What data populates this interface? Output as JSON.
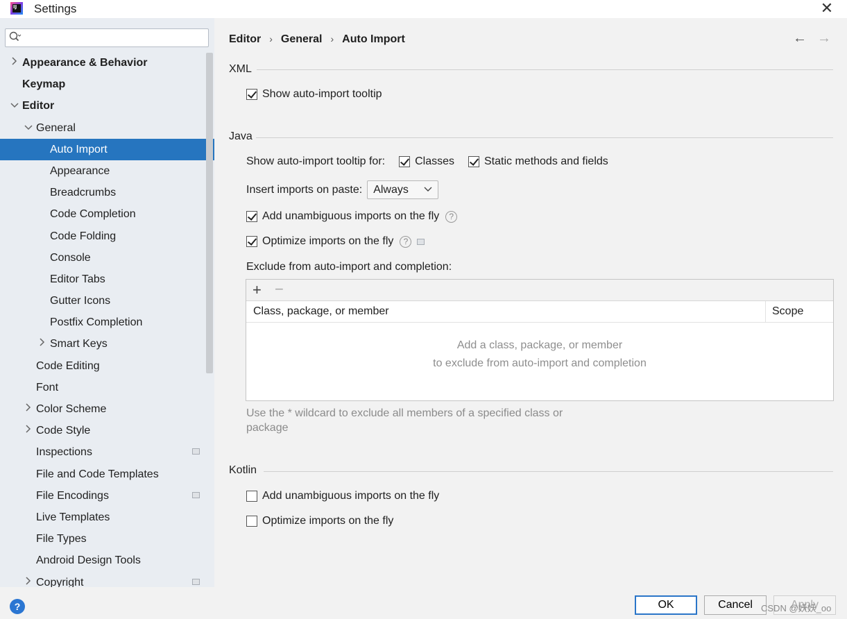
{
  "window": {
    "title": "Settings",
    "app_icon_text": "IJ"
  },
  "search": {
    "placeholder": ""
  },
  "sidebar": {
    "items": [
      {
        "label": "Appearance & Behavior",
        "indent": 0,
        "arrow": "›",
        "bold": true
      },
      {
        "label": "Keymap",
        "indent": 0,
        "arrow": "",
        "bold": true
      },
      {
        "label": "Editor",
        "indent": 0,
        "arrow": "⌄",
        "bold": true
      },
      {
        "label": "General",
        "indent": 1,
        "arrow": "⌄"
      },
      {
        "label": "Auto Import",
        "indent": 2,
        "arrow": "",
        "selected": true
      },
      {
        "label": "Appearance",
        "indent": 2,
        "arrow": ""
      },
      {
        "label": "Breadcrumbs",
        "indent": 2,
        "arrow": ""
      },
      {
        "label": "Code Completion",
        "indent": 2,
        "arrow": ""
      },
      {
        "label": "Code Folding",
        "indent": 2,
        "arrow": ""
      },
      {
        "label": "Console",
        "indent": 2,
        "arrow": ""
      },
      {
        "label": "Editor Tabs",
        "indent": 2,
        "arrow": ""
      },
      {
        "label": "Gutter Icons",
        "indent": 2,
        "arrow": ""
      },
      {
        "label": "Postfix Completion",
        "indent": 2,
        "arrow": ""
      },
      {
        "label": "Smart Keys",
        "indent": 2,
        "arrow": "›"
      },
      {
        "label": "Code Editing",
        "indent": 1,
        "arrow": ""
      },
      {
        "label": "Font",
        "indent": 1,
        "arrow": ""
      },
      {
        "label": "Color Scheme",
        "indent": 1,
        "arrow": "›"
      },
      {
        "label": "Code Style",
        "indent": 1,
        "arrow": "›"
      },
      {
        "label": "Inspections",
        "indent": 1,
        "arrow": "",
        "mini": true
      },
      {
        "label": "File and Code Templates",
        "indent": 1,
        "arrow": ""
      },
      {
        "label": "File Encodings",
        "indent": 1,
        "arrow": "",
        "mini": true
      },
      {
        "label": "Live Templates",
        "indent": 1,
        "arrow": ""
      },
      {
        "label": "File Types",
        "indent": 1,
        "arrow": ""
      },
      {
        "label": "Android Design Tools",
        "indent": 1,
        "arrow": ""
      },
      {
        "label": "Copyright",
        "indent": 1,
        "arrow": "›",
        "mini": true
      }
    ]
  },
  "breadcrumb": {
    "items": [
      "Editor",
      "General",
      "Auto Import"
    ],
    "sep": "›"
  },
  "nav": {
    "back": "←",
    "forward": "→"
  },
  "xml": {
    "title": "XML",
    "show_tooltip": {
      "label": "Show auto-import tooltip",
      "checked": true
    }
  },
  "java": {
    "title": "Java",
    "tooltip_for_label": "Show auto-import tooltip for:",
    "classes": {
      "label": "Classes",
      "checked": true
    },
    "static_members": {
      "label": "Static methods and fields",
      "checked": true
    },
    "insert_on_paste_label": "Insert imports on paste:",
    "insert_on_paste_value": "Always",
    "add_unambiguous": {
      "label": "Add unambiguous imports on the fly",
      "checked": true
    },
    "optimize": {
      "label": "Optimize imports on the fly",
      "checked": true
    },
    "exclude_label": "Exclude from auto-import and completion:",
    "table": {
      "plus": "+",
      "minus": "−",
      "col_member": "Class, package, or member",
      "col_scope": "Scope",
      "empty_line1": "Add a class, package, or member",
      "empty_line2": "to exclude from auto-import and completion"
    },
    "hint_line1": "Use the * wildcard to exclude all members of a specified class or",
    "hint_line2": "package"
  },
  "kotlin": {
    "title": "Kotlin",
    "add_unambiguous": {
      "label": "Add unambiguous imports on the fly",
      "checked": false
    },
    "optimize": {
      "label": "Optimize imports on the fly",
      "checked": false
    }
  },
  "footer": {
    "help": "?",
    "ok": "OK",
    "cancel": "Cancel",
    "apply": "Apply",
    "watermark": "CSDN @妖妖_oo"
  },
  "colors": {
    "selection": "#2675bf",
    "ok_border": "#2a75c8",
    "sidebar_bg": "#e9edf2"
  }
}
